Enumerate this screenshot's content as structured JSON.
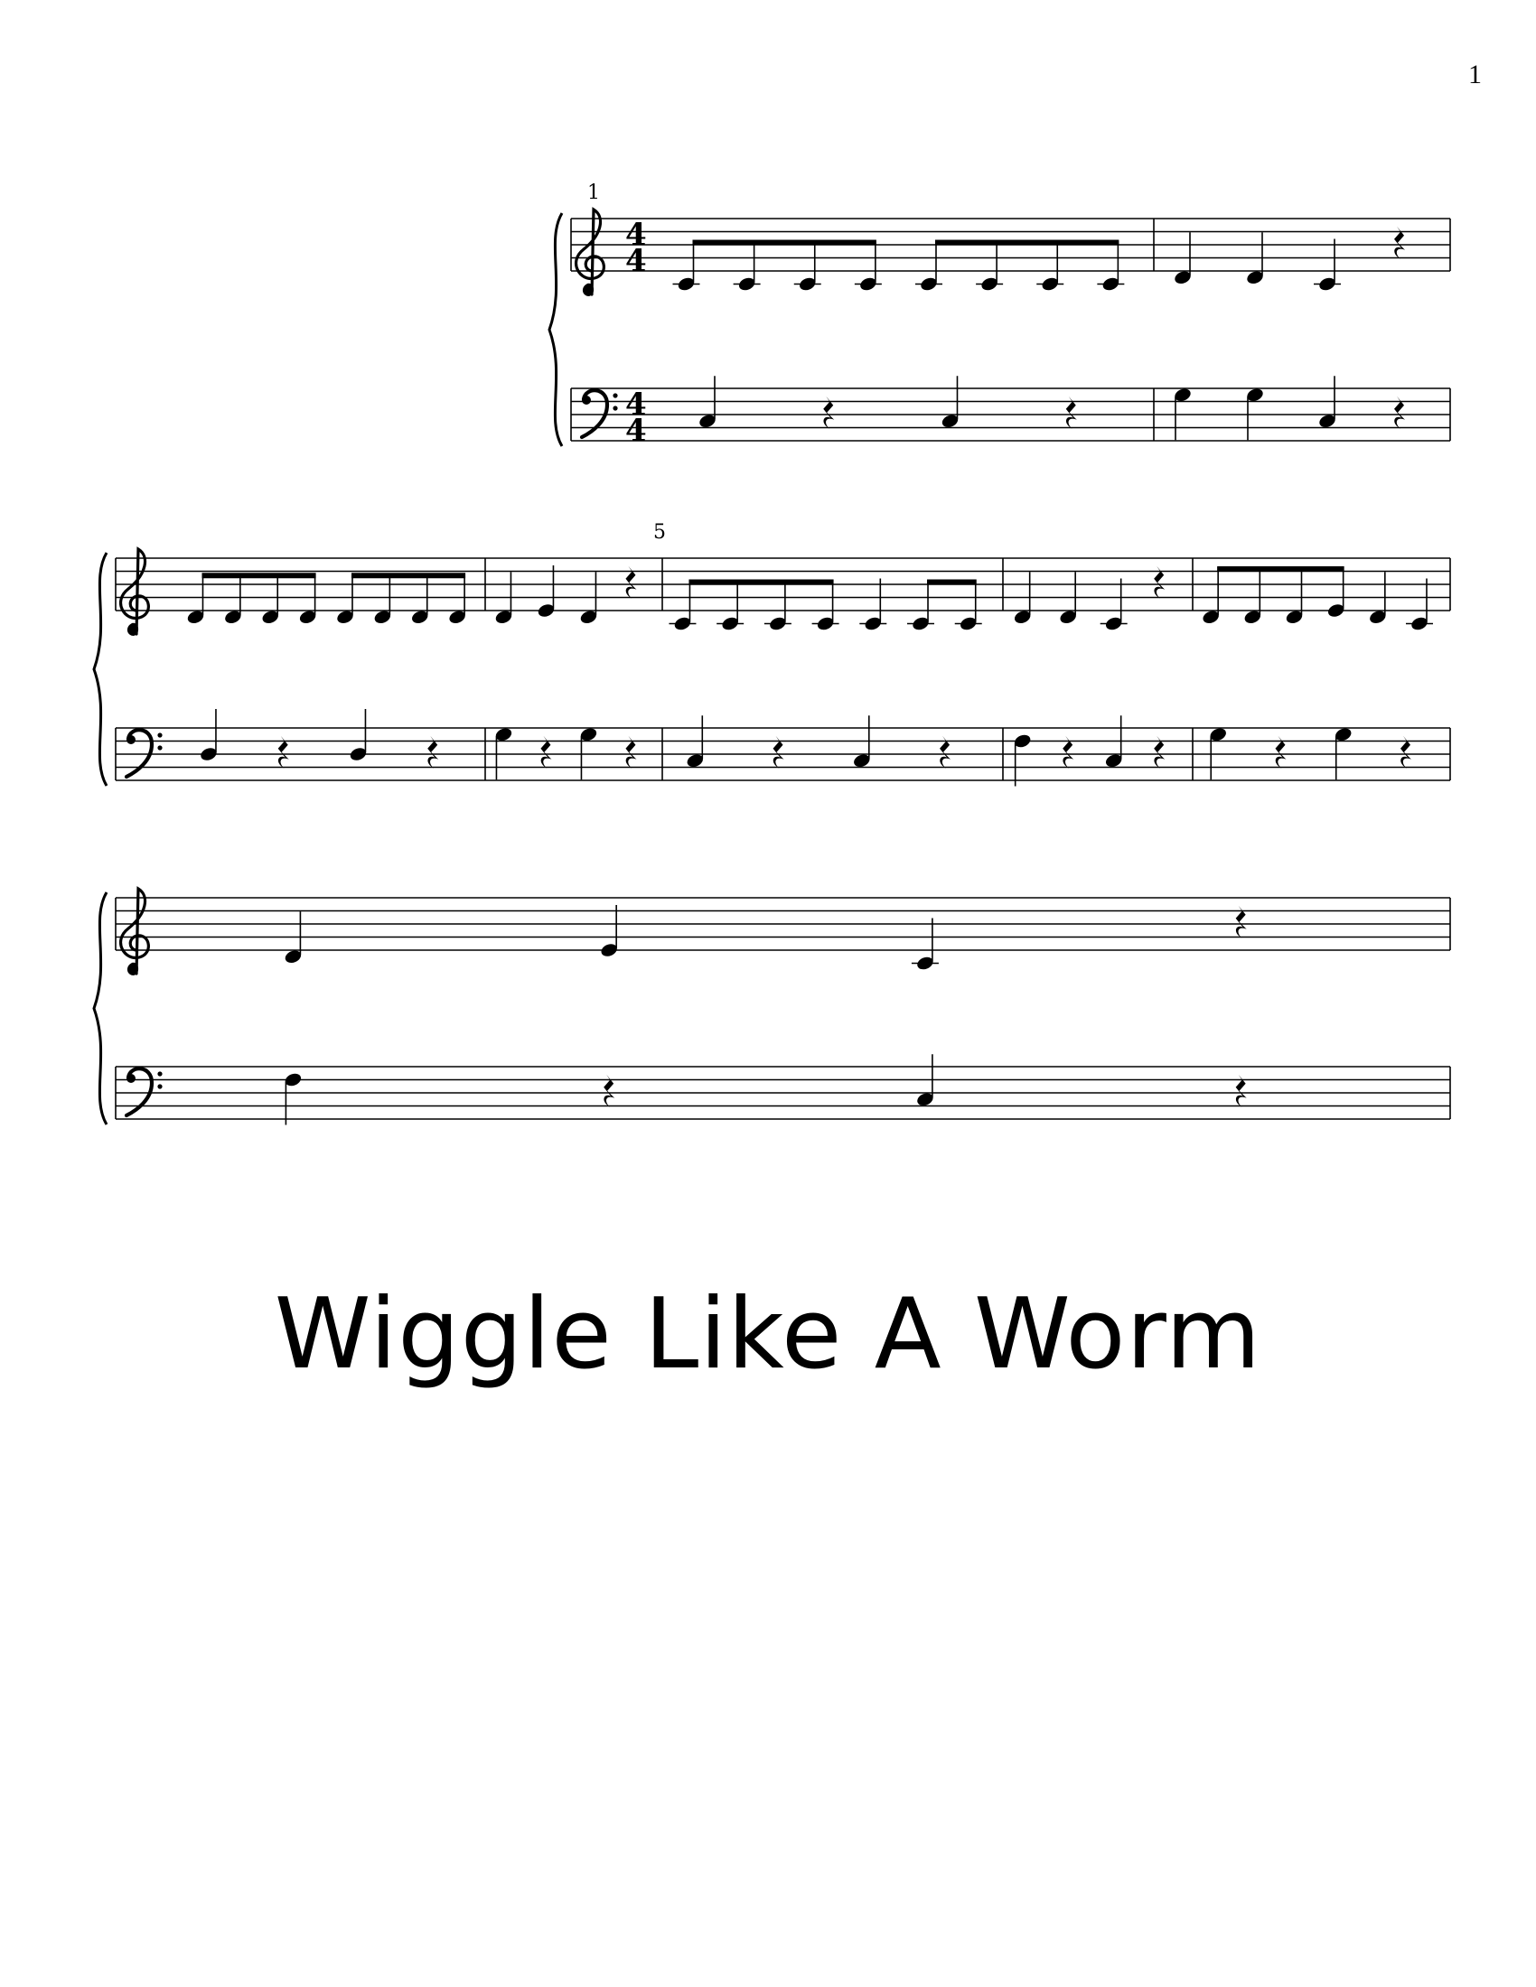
{
  "page_number": "1",
  "title": "Wiggle Like A Worm",
  "time_signature": {
    "numerator": "4",
    "denominator": "4"
  },
  "clefs": {
    "treble": "treble-clef-icon",
    "bass": "bass-clef-icon"
  },
  "measure_numbers": [
    "1",
    "5"
  ],
  "systems": [
    {
      "measure_number": "1",
      "measures": [
        {
          "treble": [
            {
              "type": "eighth",
              "pitch": "C4",
              "beam": "a"
            },
            {
              "type": "eighth",
              "pitch": "C4",
              "beam": "a"
            },
            {
              "type": "eighth",
              "pitch": "C4",
              "beam": "a"
            },
            {
              "type": "eighth",
              "pitch": "C4",
              "beam": "a"
            },
            {
              "type": "eighth",
              "pitch": "C4",
              "beam": "b"
            },
            {
              "type": "eighth",
              "pitch": "C4",
              "beam": "b"
            },
            {
              "type": "eighth",
              "pitch": "C4",
              "beam": "b"
            },
            {
              "type": "eighth",
              "pitch": "C4",
              "beam": "b"
            }
          ],
          "bass": [
            {
              "type": "quarter",
              "pitch": "C3"
            },
            {
              "type": "rest"
            },
            {
              "type": "quarter",
              "pitch": "C3"
            },
            {
              "type": "rest"
            }
          ]
        },
        {
          "treble": [
            {
              "type": "quarter",
              "pitch": "D4"
            },
            {
              "type": "quarter",
              "pitch": "D4"
            },
            {
              "type": "quarter",
              "pitch": "C4"
            },
            {
              "type": "rest"
            }
          ],
          "bass": [
            {
              "type": "quarter",
              "pitch": "G3"
            },
            {
              "type": "quarter",
              "pitch": "G3"
            },
            {
              "type": "quarter",
              "pitch": "C3"
            },
            {
              "type": "rest"
            }
          ]
        }
      ]
    },
    {
      "measure_number": "",
      "measures": [
        {
          "treble": [
            {
              "type": "eighth",
              "pitch": "D4",
              "beam": "a"
            },
            {
              "type": "eighth",
              "pitch": "D4",
              "beam": "a"
            },
            {
              "type": "eighth",
              "pitch": "D4",
              "beam": "a"
            },
            {
              "type": "eighth",
              "pitch": "D4",
              "beam": "a"
            },
            {
              "type": "eighth",
              "pitch": "D4",
              "beam": "b"
            },
            {
              "type": "eighth",
              "pitch": "D4",
              "beam": "b"
            },
            {
              "type": "eighth",
              "pitch": "D4",
              "beam": "b"
            },
            {
              "type": "eighth",
              "pitch": "D4",
              "beam": "b"
            }
          ],
          "bass": [
            {
              "type": "quarter",
              "pitch": "D3"
            },
            {
              "type": "rest"
            },
            {
              "type": "quarter",
              "pitch": "D3"
            },
            {
              "type": "rest"
            }
          ]
        },
        {
          "treble": [
            {
              "type": "quarter",
              "pitch": "D4"
            },
            {
              "type": "quarter",
              "pitch": "E4"
            },
            {
              "type": "quarter",
              "pitch": "D4"
            },
            {
              "type": "rest"
            }
          ],
          "bass": [
            {
              "type": "quarter",
              "pitch": "G3"
            },
            {
              "type": "rest"
            },
            {
              "type": "quarter",
              "pitch": "G3"
            },
            {
              "type": "rest"
            }
          ]
        },
        {
          "measure_number": "5",
          "treble": [
            {
              "type": "eighth",
              "pitch": "C4",
              "beam": "a"
            },
            {
              "type": "eighth",
              "pitch": "C4",
              "beam": "a"
            },
            {
              "type": "eighth",
              "pitch": "C4",
              "beam": "a"
            },
            {
              "type": "eighth",
              "pitch": "C4",
              "beam": "a"
            },
            {
              "type": "quarter",
              "pitch": "C4"
            },
            {
              "type": "eighth",
              "pitch": "C4",
              "beam": "b"
            },
            {
              "type": "eighth",
              "pitch": "C4",
              "beam": "b"
            }
          ],
          "bass": [
            {
              "type": "quarter",
              "pitch": "C3"
            },
            {
              "type": "rest"
            },
            {
              "type": "quarter",
              "pitch": "C3"
            },
            {
              "type": "rest"
            }
          ]
        },
        {
          "treble": [
            {
              "type": "quarter",
              "pitch": "D4"
            },
            {
              "type": "quarter",
              "pitch": "D4"
            },
            {
              "type": "quarter",
              "pitch": "C4"
            },
            {
              "type": "rest"
            }
          ],
          "bass": [
            {
              "type": "quarter",
              "pitch": "F3"
            },
            {
              "type": "rest"
            },
            {
              "type": "quarter",
              "pitch": "C3"
            },
            {
              "type": "rest"
            }
          ]
        },
        {
          "treble": [
            {
              "type": "eighth",
              "pitch": "D4",
              "beam": "a"
            },
            {
              "type": "eighth",
              "pitch": "D4",
              "beam": "a"
            },
            {
              "type": "eighth",
              "pitch": "D4",
              "beam": "a"
            },
            {
              "type": "eighth",
              "pitch": "E4",
              "beam": "a"
            },
            {
              "type": "quarter",
              "pitch": "D4"
            },
            {
              "type": "quarter",
              "pitch": "C4"
            }
          ],
          "bass": [
            {
              "type": "quarter",
              "pitch": "G3"
            },
            {
              "type": "rest"
            },
            {
              "type": "quarter",
              "pitch": "G3"
            },
            {
              "type": "rest"
            }
          ]
        }
      ]
    },
    {
      "measure_number": "",
      "measures": [
        {
          "treble": [
            {
              "type": "quarter",
              "pitch": "D4"
            },
            {
              "type": "quarter",
              "pitch": "E4"
            },
            {
              "type": "quarter",
              "pitch": "C4"
            },
            {
              "type": "rest"
            }
          ],
          "bass": [
            {
              "type": "quarter",
              "pitch": "F3"
            },
            {
              "type": "rest"
            },
            {
              "type": "quarter",
              "pitch": "C3"
            },
            {
              "type": "rest"
            }
          ]
        }
      ]
    }
  ]
}
